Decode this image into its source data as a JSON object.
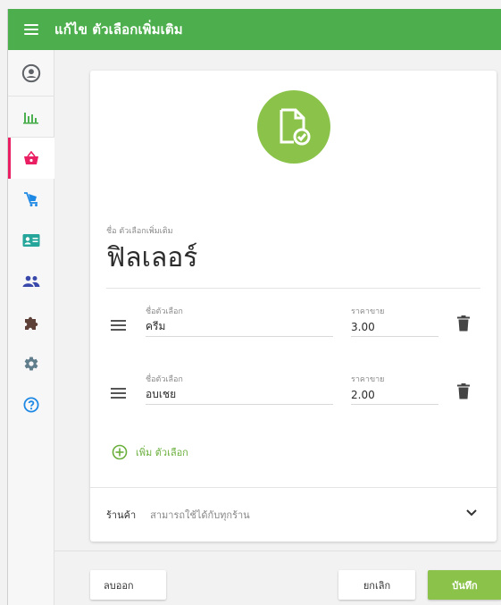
{
  "header": {
    "title": "แก้ไข ตัวเลือกเพิ่มเติม"
  },
  "colors": {
    "topbar": "#4cae4c",
    "accent_green": "#8bc34a",
    "active_nav": "#e91e63"
  },
  "sidebar": {
    "items": [
      {
        "icon": "account-circle-icon"
      },
      {
        "icon": "bar-chart-icon"
      },
      {
        "icon": "basket-icon",
        "active": true
      },
      {
        "icon": "cart-icon"
      },
      {
        "icon": "contact-card-icon"
      },
      {
        "icon": "people-icon"
      },
      {
        "icon": "puzzle-icon"
      },
      {
        "icon": "settings-icon"
      },
      {
        "icon": "help-icon"
      }
    ]
  },
  "form": {
    "name_label": "ชื่อ ตัวเลือกเพิ่มเติม",
    "name_value": "ฟิลเลอร์",
    "options": [
      {
        "name_label": "ชื่อตัวเลือก",
        "name_value": "ครีม",
        "price_label": "ราคาขาย",
        "price_value": "3.00"
      },
      {
        "name_label": "ชื่อตัวเลือก",
        "name_value": "อบเชย",
        "price_label": "ราคาขาย",
        "price_value": "2.00"
      }
    ],
    "add_option_label": "เพิ่ม ตัวเลือก",
    "stores_label": "ร้านค้า",
    "stores_value": "สามารถใช้ได้กับทุกร้าน"
  },
  "footer": {
    "delete_label": "ลบออก",
    "cancel_label": "ยกเลิก",
    "save_label": "บันทึก"
  }
}
